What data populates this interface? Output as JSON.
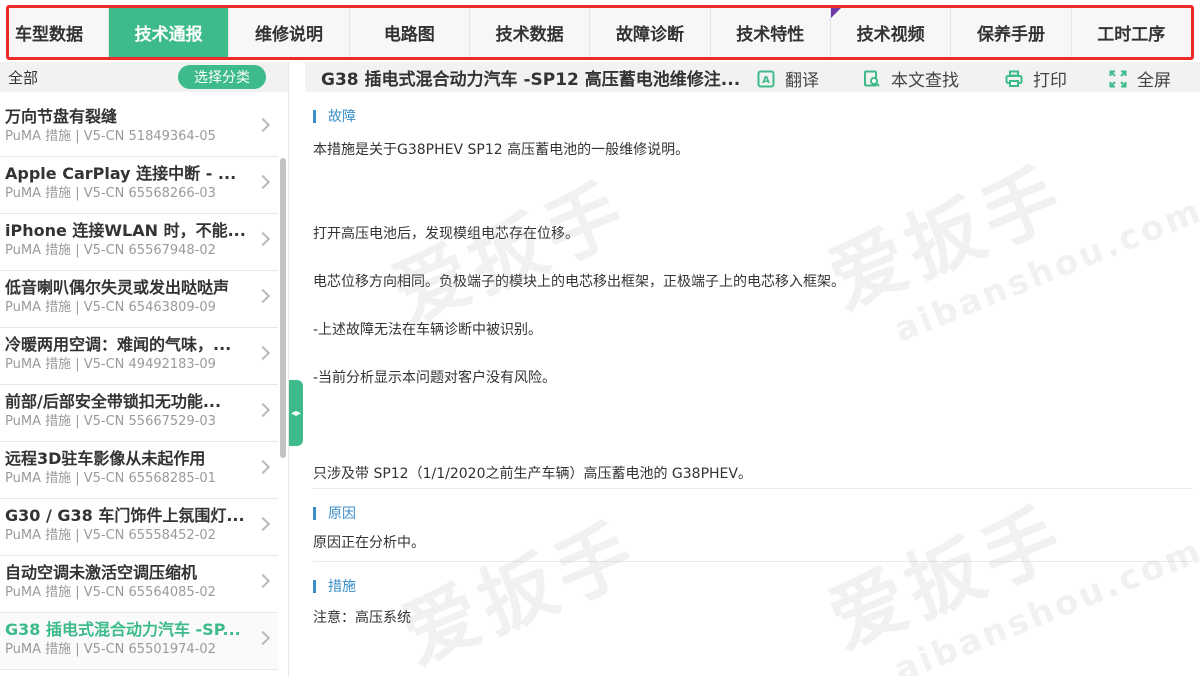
{
  "tabs": [
    {
      "label": "车型数据"
    },
    {
      "label": "技术通报"
    },
    {
      "label": "维修说明"
    },
    {
      "label": "电路图"
    },
    {
      "label": "技术数据"
    },
    {
      "label": "故障诊断"
    },
    {
      "label": "技术特性"
    },
    {
      "label": "技术视频"
    },
    {
      "label": "保养手册"
    },
    {
      "label": "工时工序"
    }
  ],
  "active_tab": "技术通报",
  "sidebar": {
    "all_label": "全部",
    "pick_category_label": "选择分类",
    "items": [
      {
        "title": "万向节盘有裂缝",
        "sub": "PuMA 措施 | V5-CN 51849364-05"
      },
      {
        "title": "Apple CarPlay 连接中断 - ...",
        "sub": "PuMA 措施 | V5-CN 65568266-03"
      },
      {
        "title": "iPhone 连接WLAN 时，不能...",
        "sub": "PuMA 措施 | V5-CN 65567948-02"
      },
      {
        "title": "低音喇叭偶尔失灵或发出哒哒声",
        "sub": "PuMA 措施 | V5-CN 65463809-09"
      },
      {
        "title": "冷暖两用空调：难闻的气味，...",
        "sub": "PuMA 措施 | V5-CN 49492183-09"
      },
      {
        "title": "前部/后部安全带锁扣无功能...",
        "sub": "PuMA 措施 | V5-CN 55667529-03"
      },
      {
        "title": "远程3D驻车影像从未起作用",
        "sub": "PuMA 措施 | V5-CN 65568285-01"
      },
      {
        "title": "G30 / G38 车门饰件上氛围灯...",
        "sub": "PuMA 措施 | V5-CN 65558452-02"
      },
      {
        "title": "自动空调未激活空调压缩机",
        "sub": "PuMA 措施 | V5-CN 65564085-02"
      },
      {
        "title": "G38 插电式混合动力汽车 -SP...",
        "sub": "PuMA 措施 | V5-CN 65501974-02"
      }
    ]
  },
  "document": {
    "title": "G38 插电式混合动力汽车 -SP12 高压蓄电池维修注...",
    "toolbar": {
      "translate": "翻译",
      "find": "本文查找",
      "print": "打印",
      "fullscreen": "全屏"
    },
    "sections": {
      "fault": {
        "heading": "故障",
        "p1": "本措施是关于G38PHEV SP12 高压蓄电池的一般维修说明。",
        "p2": "打开高压电池后，发现模组电芯存在位移。",
        "p3": "电芯位移方向相同。负极端子的模块上的电芯移出框架，正极端子上的电芯移入框架。",
        "p4": "-上述故障无法在车辆诊断中被识别。",
        "p5": "-当前分析显示本问题对客户没有风险。",
        "p6": "只涉及带 SP12（1/1/2020之前生产车辆）高压蓄电池的 G38PHEV。"
      },
      "cause": {
        "heading": "原因",
        "p1": "原因正在分析中。"
      },
      "measure": {
        "heading": "措施",
        "p1": "注意：高压系统"
      }
    },
    "watermark": {
      "text": "爱扳手",
      "sub": "aibanshou.com"
    }
  },
  "colors": {
    "accent": "#3dbb8a",
    "highlight_border": "#ee2b2b",
    "section_blue": "#3a8ec9"
  }
}
